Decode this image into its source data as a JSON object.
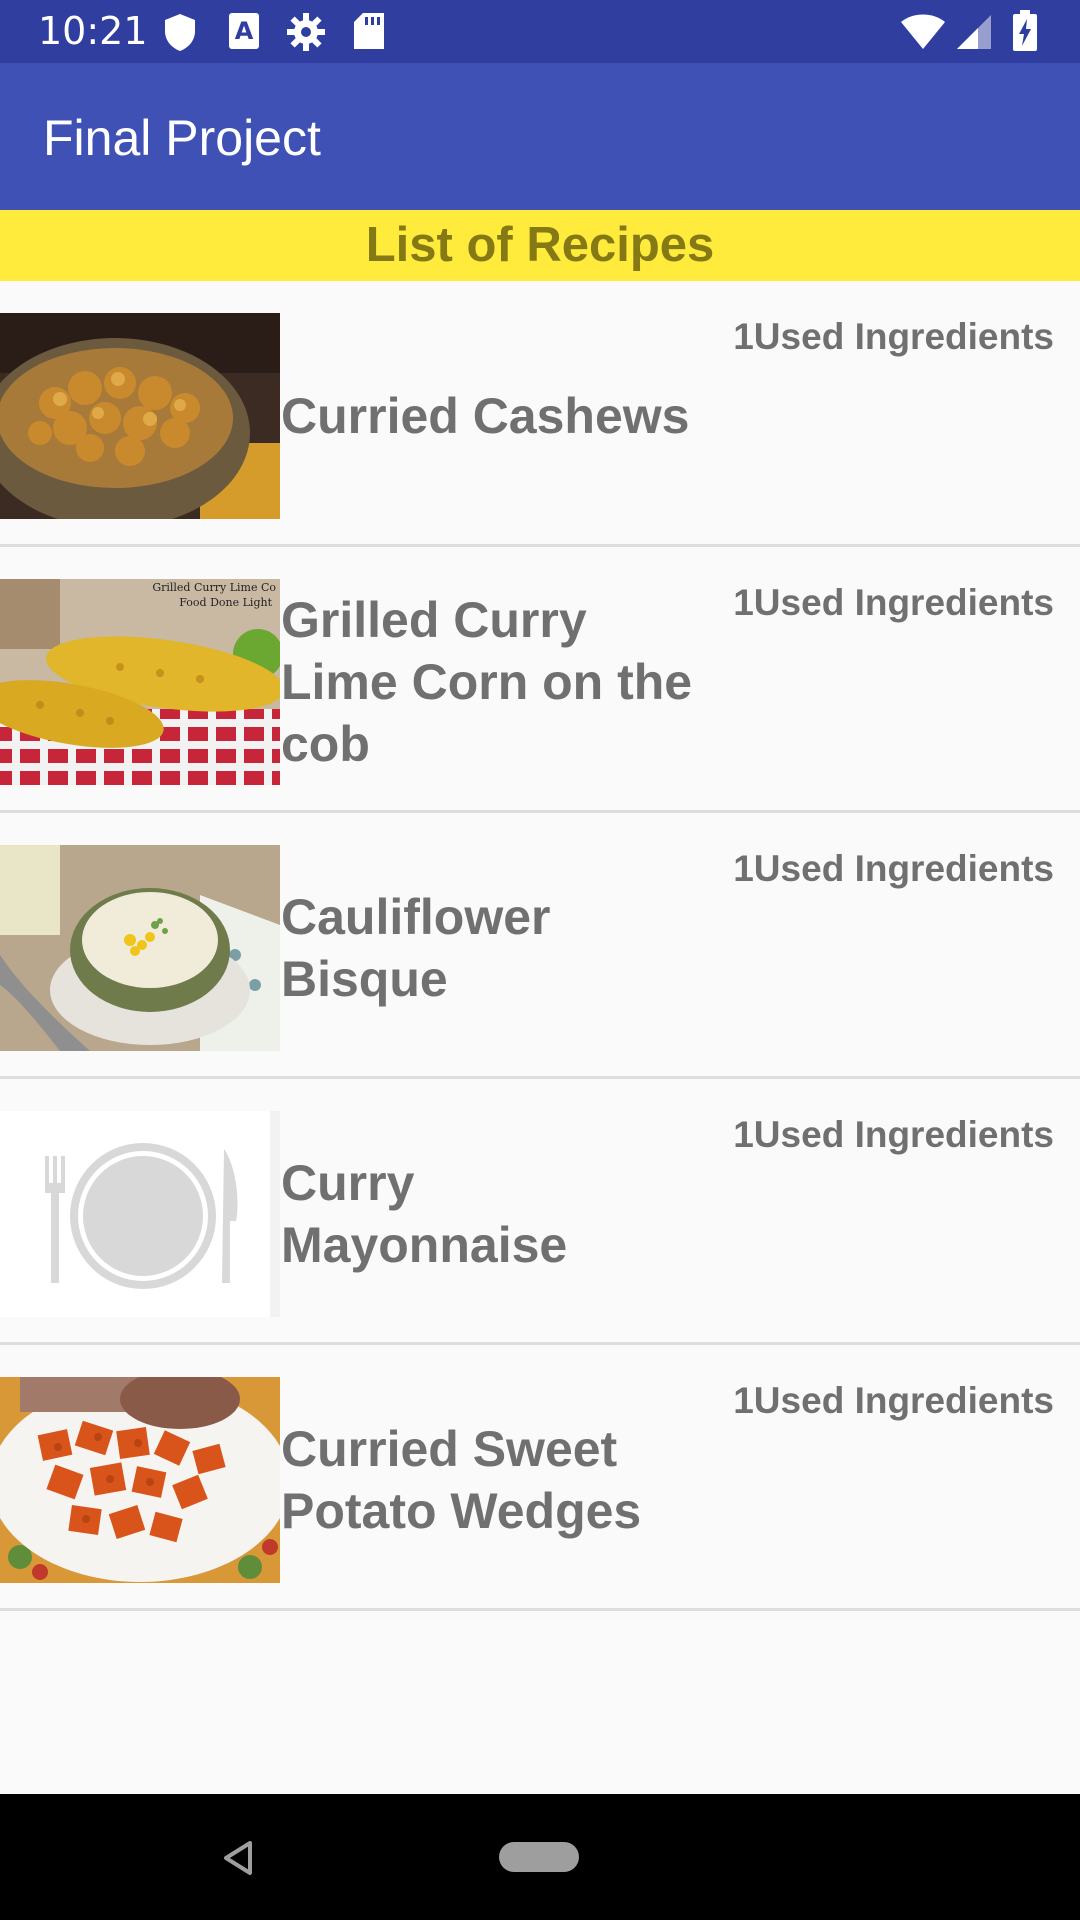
{
  "status_bar": {
    "time": "10:21",
    "icons": [
      "shield-icon",
      "a-keyboard-icon",
      "gear-icon",
      "sd-card-icon",
      "wifi-icon",
      "signal-icon",
      "battery-charging-icon"
    ]
  },
  "app_bar": {
    "title": "Final Project"
  },
  "header": {
    "title": "List of Recipes"
  },
  "recipes": [
    {
      "title": "Curried Cashews",
      "used": "1Used Ingredients",
      "thumb": "curried-cashews"
    },
    {
      "title": "Grilled Curry Lime Corn on the cob",
      "used": "1Used Ingredients",
      "thumb": "grilled-corn",
      "thumb_caption_1": "Grilled Curry Lime Co",
      "thumb_caption_2": "Food Done Light"
    },
    {
      "title": "Cauliflower Bisque",
      "used": "1Used Ingredients",
      "thumb": "cauliflower-bisque"
    },
    {
      "title": "Curry Mayonnaise",
      "used": "1Used Ingredients",
      "thumb": "placeholder-plate"
    },
    {
      "title": "Curried Sweet Potato Wedges",
      "used": "1Used Ingredients",
      "thumb": "sweet-potato-wedges"
    }
  ],
  "nav_bar": {
    "icons": [
      "back-icon",
      "home-pill-icon"
    ]
  },
  "colors": {
    "status_bar": "#303f9f",
    "app_bar": "#3f51b5",
    "header_bg": "#ffeb3b",
    "header_text": "#857916",
    "item_text": "#707070"
  }
}
